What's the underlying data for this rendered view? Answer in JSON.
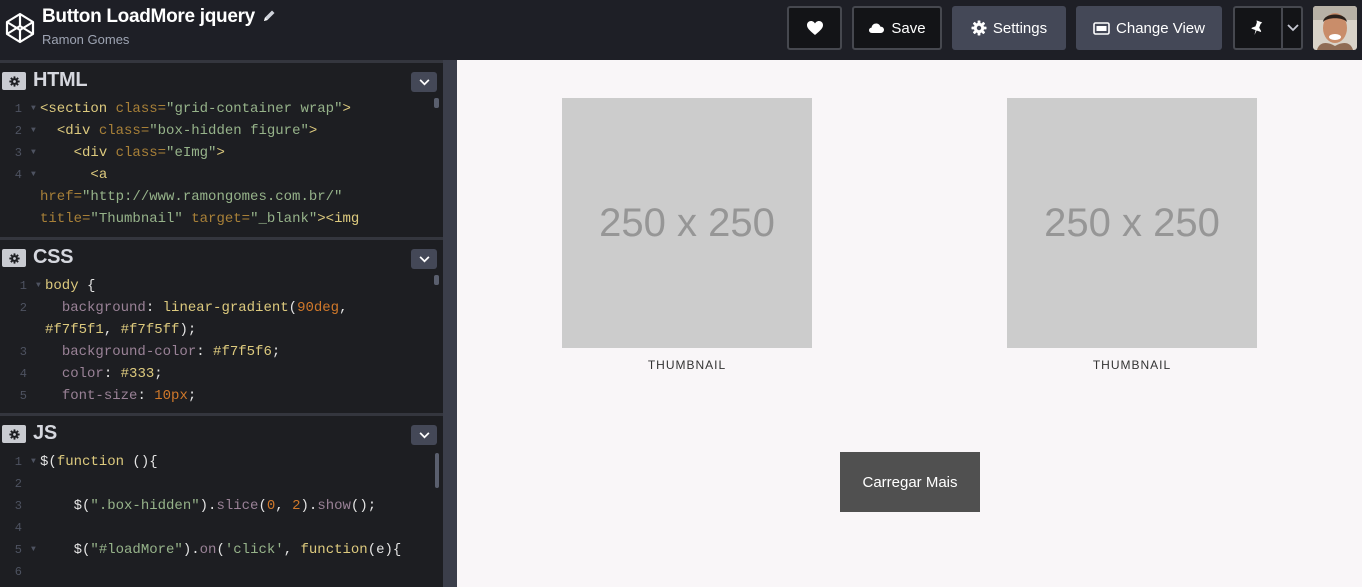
{
  "header": {
    "title": "Button LoadMore jquery",
    "author": "Ramon Gomes",
    "buttons": {
      "save": "Save",
      "settings": "Settings",
      "change_view": "Change View"
    },
    "icons": {
      "logo": "codepen-logo-icon",
      "edit": "pencil-icon",
      "heart": "heart-icon",
      "save": "cloud-icon",
      "settings": "gear-icon",
      "change_view": "layout-icon",
      "pin": "pin-icon",
      "dropdown": "chevron-down-icon"
    }
  },
  "editors": {
    "html": {
      "title": "HTML",
      "lines": [
        {
          "n": "1",
          "fold": true,
          "tokens": [
            [
              "t-tag",
              "<section "
            ],
            [
              "t-attr",
              "class="
            ],
            [
              "t-str",
              "\"grid-container wrap\""
            ],
            [
              "t-tag",
              ">"
            ]
          ]
        },
        {
          "n": "2",
          "fold": true,
          "tokens": [
            [
              "t-plain",
              "  "
            ],
            [
              "t-tag",
              "<div "
            ],
            [
              "t-attr",
              "class="
            ],
            [
              "t-str",
              "\"box-hidden figure\""
            ],
            [
              "t-tag",
              ">"
            ]
          ]
        },
        {
          "n": "3",
          "fold": true,
          "tokens": [
            [
              "t-plain",
              "    "
            ],
            [
              "t-tag",
              "<div "
            ],
            [
              "t-attr",
              "class="
            ],
            [
              "t-str",
              "\"eImg\""
            ],
            [
              "t-tag",
              ">"
            ]
          ]
        },
        {
          "n": "4",
          "fold": true,
          "tokens": [
            [
              "t-plain",
              "      "
            ],
            [
              "t-tag",
              "<a"
            ]
          ]
        },
        {
          "n": "",
          "fold": false,
          "tokens": [
            [
              "t-attr",
              "href="
            ],
            [
              "t-str",
              "\"http://www.ramongomes.com.br/\""
            ]
          ]
        },
        {
          "n": "",
          "fold": false,
          "tokens": [
            [
              "t-attr",
              "title="
            ],
            [
              "t-str",
              "\"Thumbnail\" "
            ],
            [
              "t-attr",
              "target="
            ],
            [
              "t-str",
              "\"_blank\""
            ],
            [
              "t-tag",
              "><img"
            ]
          ]
        }
      ]
    },
    "css": {
      "title": "CSS",
      "lines": [
        {
          "n": "1",
          "fold": true,
          "tokens": [
            [
              "t-sel",
              "body "
            ],
            [
              "t-plain",
              "{"
            ]
          ]
        },
        {
          "n": "2",
          "fold": false,
          "tokens": [
            [
              "t-plain",
              "  "
            ],
            [
              "t-prop",
              "background"
            ],
            [
              "t-plain",
              ": "
            ],
            [
              "t-val",
              "linear-gradient"
            ],
            [
              "t-plain",
              "("
            ],
            [
              "t-num",
              "90deg"
            ],
            [
              "t-plain",
              ","
            ]
          ]
        },
        {
          "n": "",
          "fold": false,
          "tokens": [
            [
              "t-val",
              "#f7f5f1"
            ],
            [
              "t-plain",
              ", "
            ],
            [
              "t-val",
              "#f7f5ff"
            ],
            [
              "t-plain",
              ");"
            ]
          ]
        },
        {
          "n": "3",
          "fold": false,
          "tokens": [
            [
              "t-plain",
              "  "
            ],
            [
              "t-prop",
              "background-color"
            ],
            [
              "t-plain",
              ": "
            ],
            [
              "t-val",
              "#f7f5f6"
            ],
            [
              "t-plain",
              ";"
            ]
          ]
        },
        {
          "n": "4",
          "fold": false,
          "tokens": [
            [
              "t-plain",
              "  "
            ],
            [
              "t-prop",
              "color"
            ],
            [
              "t-plain",
              ": "
            ],
            [
              "t-val",
              "#333"
            ],
            [
              "t-plain",
              ";"
            ]
          ]
        },
        {
          "n": "5",
          "fold": false,
          "tokens": [
            [
              "t-plain",
              "  "
            ],
            [
              "t-prop",
              "font-size"
            ],
            [
              "t-plain",
              ": "
            ],
            [
              "t-num",
              "10px"
            ],
            [
              "t-plain",
              ";"
            ]
          ]
        }
      ]
    },
    "js": {
      "title": "JS",
      "lines": [
        {
          "n": "1",
          "fold": true,
          "tokens": [
            [
              "t-plain",
              "$("
            ],
            [
              "t-kw",
              "function"
            ],
            [
              "t-plain",
              " (){"
            ]
          ]
        },
        {
          "n": "2",
          "fold": false,
          "tokens": []
        },
        {
          "n": "3",
          "fold": false,
          "tokens": [
            [
              "t-plain",
              "    $("
            ],
            [
              "t-str",
              "\".box-hidden\""
            ],
            [
              "t-plain",
              ")."
            ],
            [
              "t-meth",
              "slice"
            ],
            [
              "t-plain",
              "("
            ],
            [
              "t-num",
              "0"
            ],
            [
              "t-plain",
              ", "
            ],
            [
              "t-num",
              "2"
            ],
            [
              "t-plain",
              ")."
            ],
            [
              "t-meth",
              "show"
            ],
            [
              "t-plain",
              "();"
            ]
          ]
        },
        {
          "n": "4",
          "fold": false,
          "tokens": []
        },
        {
          "n": "5",
          "fold": true,
          "tokens": [
            [
              "t-plain",
              "    $("
            ],
            [
              "t-str",
              "\"#loadMore\""
            ],
            [
              "t-plain",
              ")."
            ],
            [
              "t-meth",
              "on"
            ],
            [
              "t-plain",
              "("
            ],
            [
              "t-str",
              "'click'"
            ],
            [
              "t-plain",
              ", "
            ],
            [
              "t-kw",
              "function"
            ],
            [
              "t-plain",
              "(e){"
            ]
          ]
        },
        {
          "n": "6",
          "fold": false,
          "tokens": []
        }
      ]
    }
  },
  "preview": {
    "thumbnails": [
      {
        "placeholder": "250 x 250",
        "caption": "THUMBNAIL"
      },
      {
        "placeholder": "250 x 250",
        "caption": "THUMBNAIL"
      }
    ],
    "load_more": "Carregar Mais"
  },
  "colors": {
    "header_bg": "#1e1f26",
    "editor_bg": "#1d1e22",
    "preview_bg": "#f9f6f8",
    "thumb_bg": "#cccccc",
    "button_bg": "#505050"
  }
}
